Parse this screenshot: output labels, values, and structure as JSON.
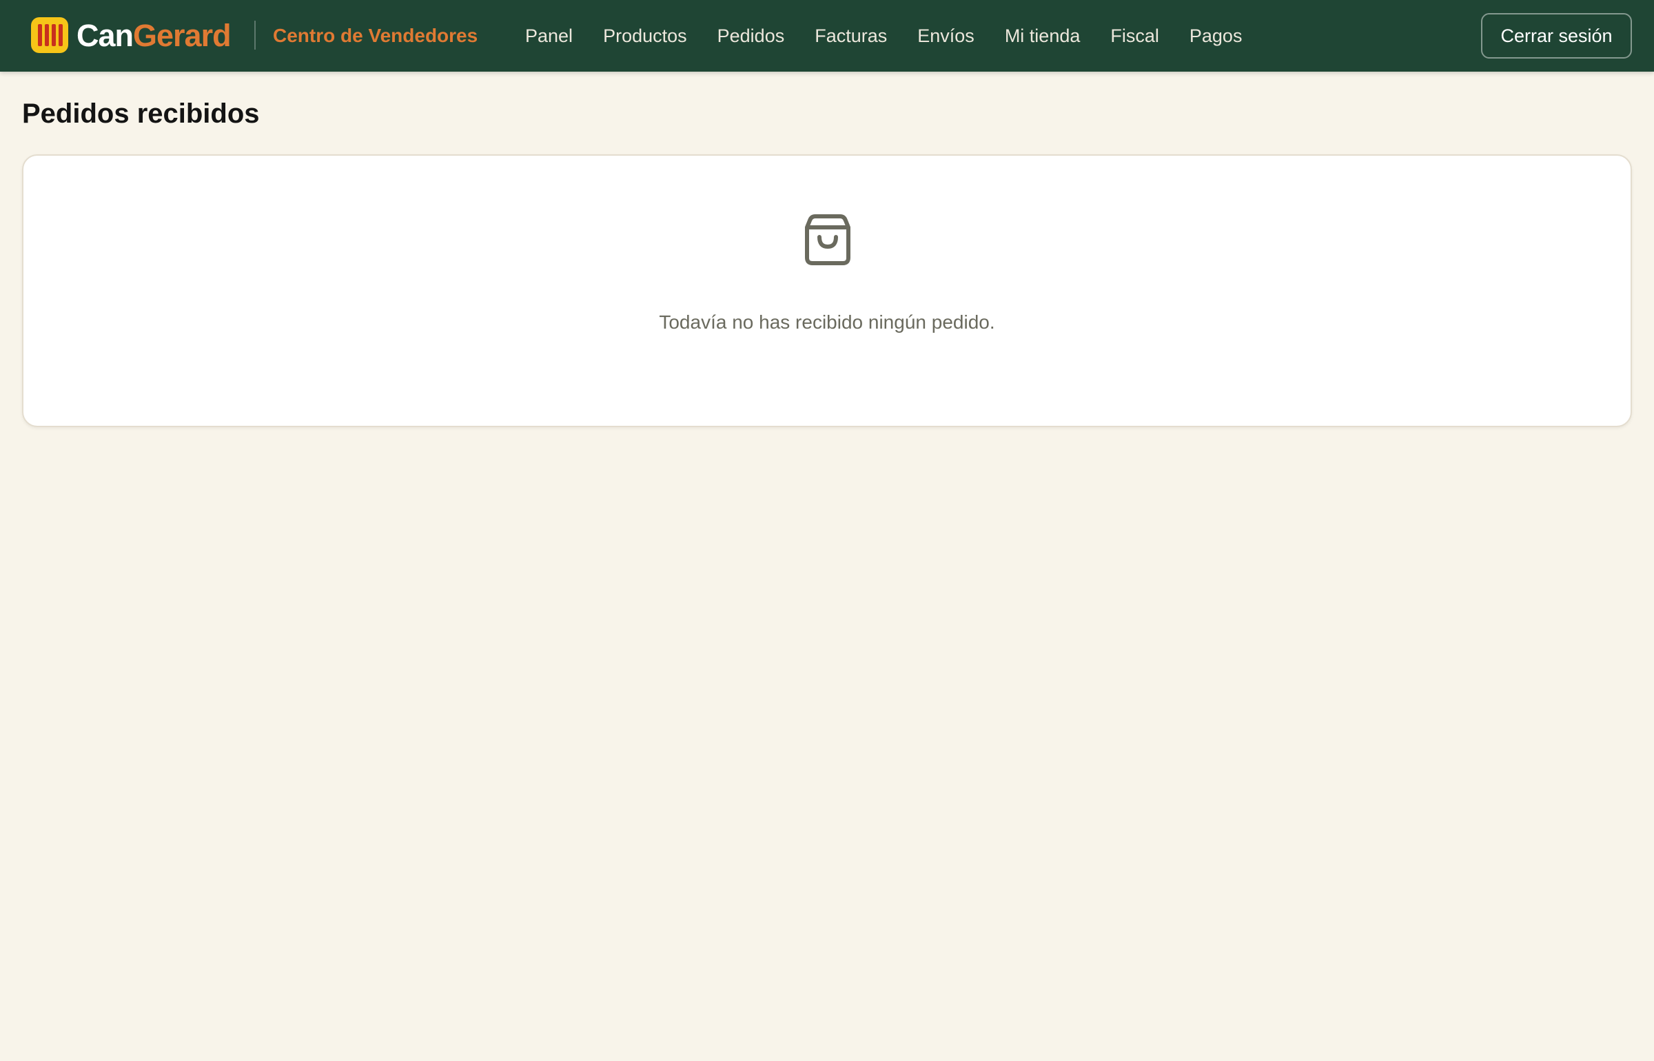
{
  "header": {
    "brand_part1": "Can",
    "brand_part2": "Gerard",
    "subtitle": "Centro de Vendedores",
    "logo_icon": "catalan-flag-icon",
    "colors": {
      "bar": "#1f4534",
      "accent": "#e07a33",
      "logo_yellow": "#f6c518",
      "logo_red": "#c8301e"
    }
  },
  "nav": {
    "items": [
      {
        "label": "Panel"
      },
      {
        "label": "Productos"
      },
      {
        "label": "Pedidos"
      },
      {
        "label": "Facturas"
      },
      {
        "label": "Envíos"
      },
      {
        "label": "Mi tienda"
      },
      {
        "label": "Fiscal"
      },
      {
        "label": "Pagos"
      }
    ]
  },
  "actions": {
    "logout_label": "Cerrar sesión"
  },
  "main": {
    "title": "Pedidos recibidos",
    "empty_state": {
      "icon": "shopping-bag-icon",
      "message": "Todavía no has recibido ningún pedido."
    }
  }
}
